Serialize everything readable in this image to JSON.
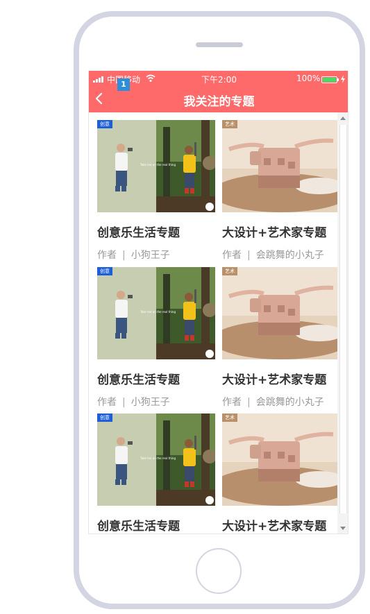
{
  "status_bar": {
    "carrier": "中国移动",
    "time": "下午2:00",
    "battery": "100%",
    "badge": "1"
  },
  "header": {
    "title": "我关注的专题"
  },
  "cards": [
    {
      "tag": "创意",
      "title": "创意乐生活专题",
      "author_label": "作者",
      "separator": "|",
      "author": "小狗王子",
      "image_text": "Take me on the real thing"
    },
    {
      "tag": "艺术",
      "title": "大设计+艺术家专题",
      "author_label": "作者",
      "separator": "|",
      "author": "会跳舞的小丸子"
    },
    {
      "tag": "创意",
      "title": "创意乐生活专题",
      "author_label": "作者",
      "separator": "|",
      "author": "小狗王子",
      "image_text": "Take me on the real thing"
    },
    {
      "tag": "艺术",
      "title": "大设计+艺术家专题",
      "author_label": "作者",
      "separator": "|",
      "author": "会跳舞的小丸子"
    },
    {
      "tag": "创意",
      "title": "创意乐生活专题",
      "image_text": "Take me on the real thing"
    },
    {
      "tag": "艺术",
      "title": "大设计+艺术家专题"
    }
  ],
  "colors": {
    "header_bg": "#fe6a69",
    "phone_frame": "#d3d6e2"
  }
}
